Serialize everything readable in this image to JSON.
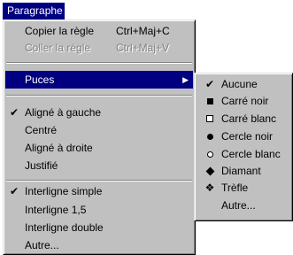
{
  "menubar": {
    "title": "Paragraphe"
  },
  "main_menu": {
    "items": [
      {
        "label": "Copier la règle",
        "shortcut": "Ctrl+Maj+C"
      },
      {
        "label": "Coller la règle",
        "shortcut": "Ctrl+Maj+V",
        "disabled": true
      },
      {
        "label": "Puces",
        "highlighted": true,
        "has_submenu": true
      },
      {
        "label": "Aligné à gauche",
        "checked": true
      },
      {
        "label": "Centré"
      },
      {
        "label": "Aligné à droite"
      },
      {
        "label": "Justifié"
      },
      {
        "label": "Interligne simple",
        "checked": true
      },
      {
        "label": "Interligne 1,5"
      },
      {
        "label": "Interligne double"
      },
      {
        "label": "Autre..."
      }
    ],
    "check_glyph": "✔",
    "submenu_arrow": "▶"
  },
  "submenu": {
    "items": [
      {
        "label": "Aucune",
        "checked": true,
        "icon": "check-icon"
      },
      {
        "label": "Carré noir",
        "icon": "filled-square-icon"
      },
      {
        "label": "Carré blanc",
        "icon": "empty-square-icon"
      },
      {
        "label": "Cercle noir",
        "icon": "filled-circle-icon"
      },
      {
        "label": "Cercle blanc",
        "icon": "empty-circle-icon"
      },
      {
        "label": "Diamant",
        "icon": "diamond-icon"
      },
      {
        "label": "Trèfle",
        "icon": "clover-icon"
      },
      {
        "label": "Autre..."
      }
    ],
    "check_glyph": "✔",
    "clover_glyph": "❖"
  },
  "colors": {
    "menu_bg": "#c0c0c0",
    "highlight": "#000080",
    "disabled": "#808080"
  }
}
